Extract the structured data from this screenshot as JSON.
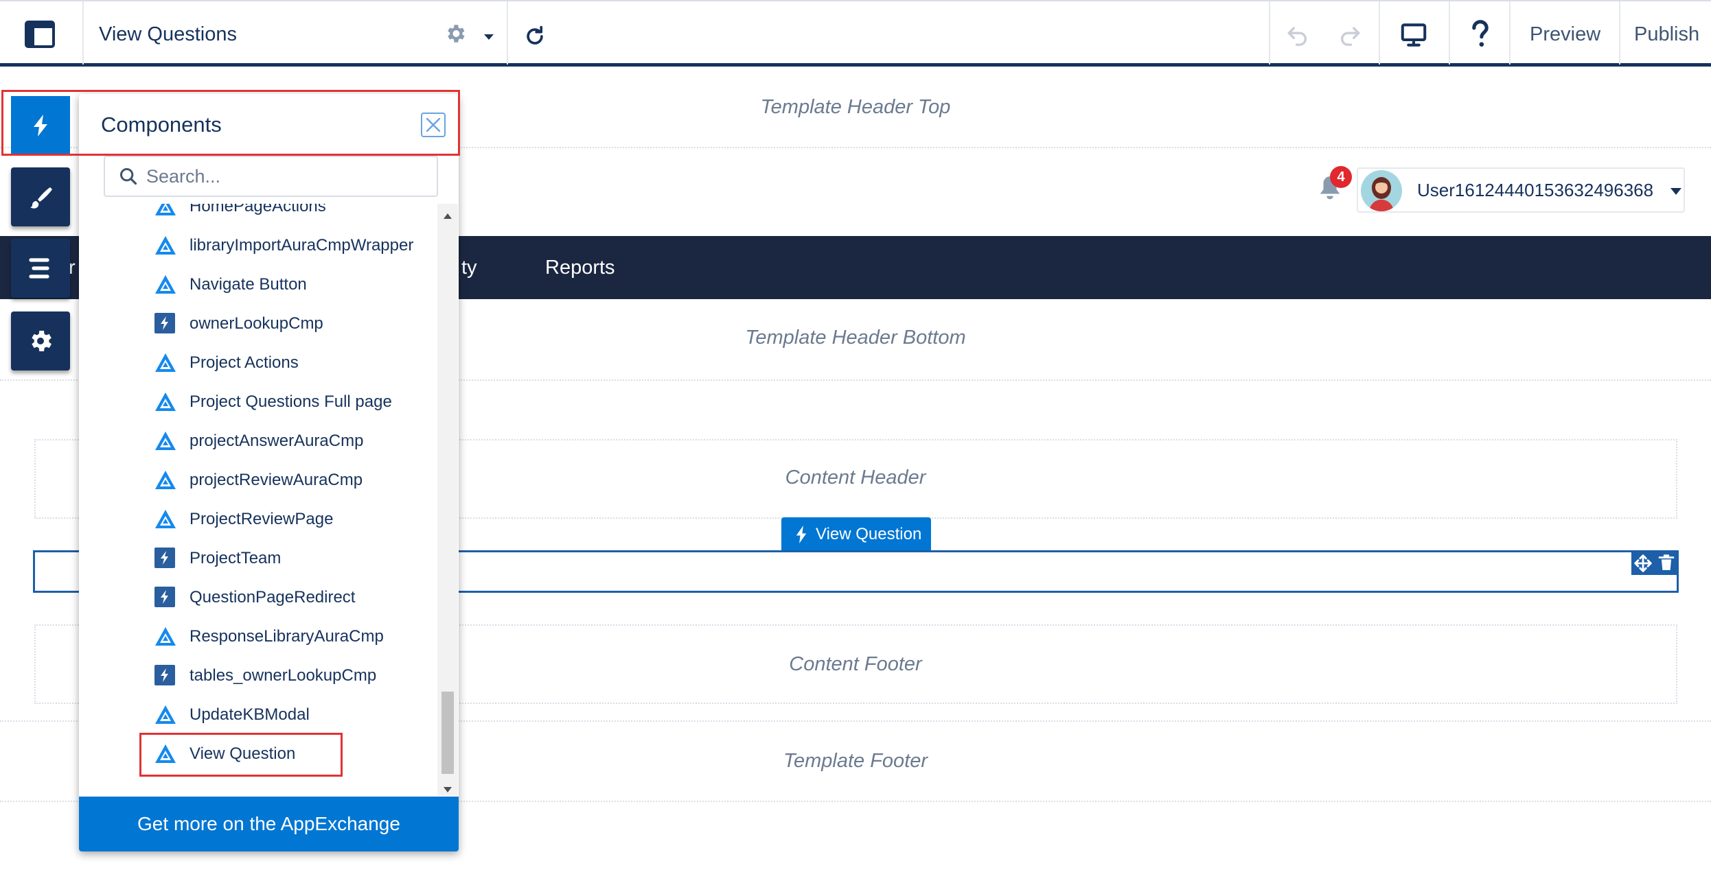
{
  "toolbar": {
    "title": "View Questions",
    "preview_label": "Preview",
    "publish_label": "Publish"
  },
  "canvas": {
    "template_header_top": "Template Header Top",
    "template_header_bottom": "Template Header Bottom",
    "content_header": "Content Header",
    "content_footer": "Content Footer",
    "template_footer": "Template Footer",
    "user_name": "User16124440153632496368",
    "notification_count": "4",
    "nav_items": [
      "ty",
      "Reports"
    ],
    "nav_left_fragment": "r",
    "selected_component_tag": "View Question"
  },
  "panel": {
    "title": "Components",
    "search_placeholder": "Search...",
    "footer_label": "Get more on the AppExchange",
    "items": [
      {
        "label": "HomePageActions",
        "icon": "lwc-icon"
      },
      {
        "label": "libraryImportAuraCmpWrapper",
        "icon": "lwc-icon"
      },
      {
        "label": "Navigate Button",
        "icon": "lwc-icon"
      },
      {
        "label": "ownerLookupCmp",
        "icon": "aura-icon"
      },
      {
        "label": "Project Actions",
        "icon": "lwc-icon"
      },
      {
        "label": "Project Questions Full page",
        "icon": "lwc-icon"
      },
      {
        "label": "projectAnswerAuraCmp",
        "icon": "lwc-icon"
      },
      {
        "label": "projectReviewAuraCmp",
        "icon": "lwc-icon"
      },
      {
        "label": "ProjectReviewPage",
        "icon": "lwc-icon"
      },
      {
        "label": "ProjectTeam",
        "icon": "aura-icon"
      },
      {
        "label": "QuestionPageRedirect",
        "icon": "aura-icon"
      },
      {
        "label": "ResponseLibraryAuraCmp",
        "icon": "lwc-icon"
      },
      {
        "label": "tables_ownerLookupCmp",
        "icon": "aura-icon"
      },
      {
        "label": "UpdateKBModal",
        "icon": "lwc-icon"
      },
      {
        "label": "View Question",
        "icon": "lwc-icon"
      }
    ]
  },
  "colors": {
    "brand": "#0176d3",
    "navy": "#16325c",
    "nav_bg": "#1b2741",
    "highlight": "#e03333",
    "badge": "#e0282e"
  }
}
